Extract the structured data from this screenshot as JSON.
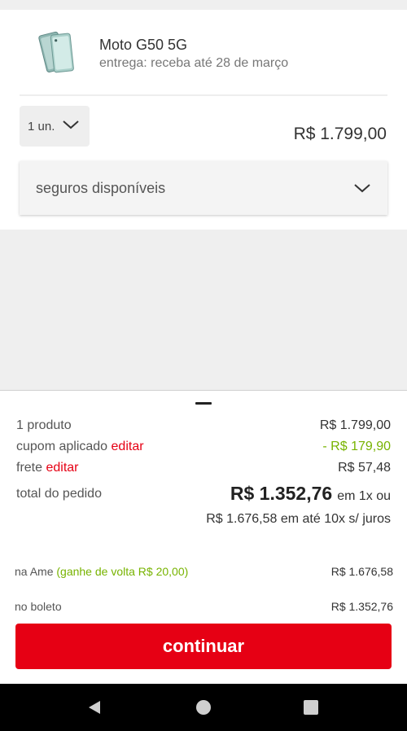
{
  "product": {
    "name": "Moto G50 5G",
    "delivery": "entrega: receba até 28 de março",
    "quantity": "1 un.",
    "price": "R$ 1.799,00"
  },
  "insurance": {
    "label": "seguros disponíveis"
  },
  "summary": {
    "products_label": "1 produto",
    "products_value": "R$ 1.799,00",
    "coupon_label": "cupom aplicado",
    "coupon_edit": "editar",
    "coupon_value": "- R$ 179,90",
    "shipping_label": "frete",
    "shipping_edit": "editar",
    "shipping_value": "R$ 57,48",
    "total_label": "total do pedido",
    "total_value": "R$ 1.352,76",
    "total_suffix": "em 1x ou",
    "installments": "R$ 1.676,58 em até 10x s/ juros"
  },
  "payments": [
    {
      "label": "na Ame",
      "cashback": "(ganhe de volta R$ 20,00)",
      "value": "R$ 1.676,58"
    },
    {
      "label": "no boleto",
      "value": "R$ 1.352,76"
    }
  ],
  "actions": {
    "continue_label": "continuar"
  },
  "colors": {
    "brand_red": "#e60014",
    "discount_green": "#77b300"
  },
  "icons": {
    "qty_chevron": "chevron-down-icon",
    "insurance_chevron": "chevron-down-icon",
    "nav_back": "triangle-back-icon",
    "nav_home": "circle-home-icon",
    "nav_recent": "square-recent-icon"
  }
}
